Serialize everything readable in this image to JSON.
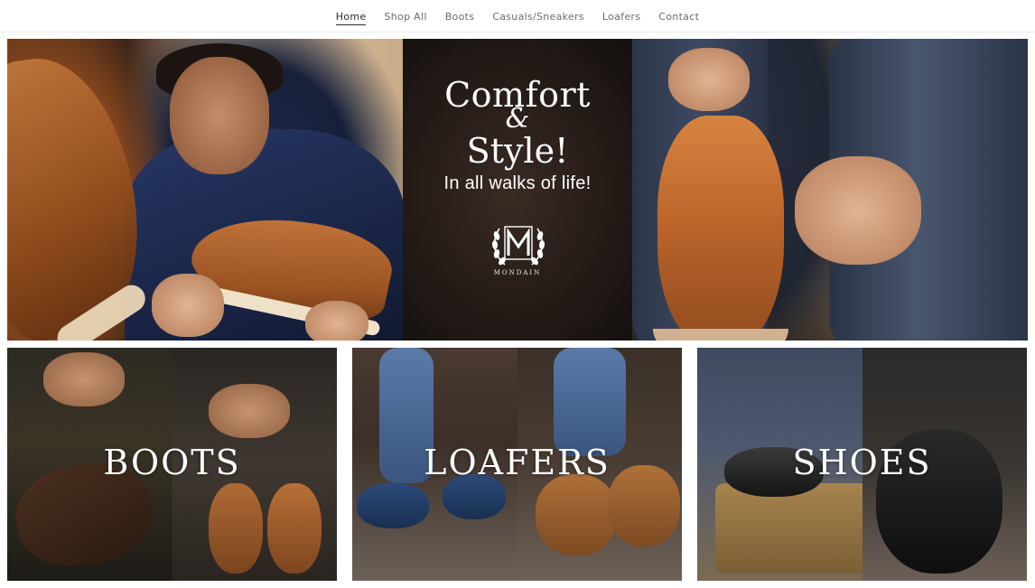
{
  "nav": {
    "items": [
      {
        "label": "Home",
        "active": true
      },
      {
        "label": "Shop All",
        "active": false
      },
      {
        "label": "Boots",
        "active": false
      },
      {
        "label": "Casuals/Sneakers",
        "active": false
      },
      {
        "label": "Loafers",
        "active": false
      },
      {
        "label": "Contact",
        "active": false
      }
    ]
  },
  "hero": {
    "title_line1": "Comfort",
    "title_amp": "&",
    "title_line2": "Style!",
    "subtitle": "In all walks of life!",
    "logo_icon": "mondain-laurel-m-logo",
    "logo_name": "MONDAIN"
  },
  "categories": [
    {
      "label": "BOOTS"
    },
    {
      "label": "LOAFERS"
    },
    {
      "label": "SHOES"
    }
  ],
  "colors": {
    "nav_text": "#6b6b6b",
    "nav_active": "#2b2b2b",
    "hero_text": "#ffffff"
  }
}
